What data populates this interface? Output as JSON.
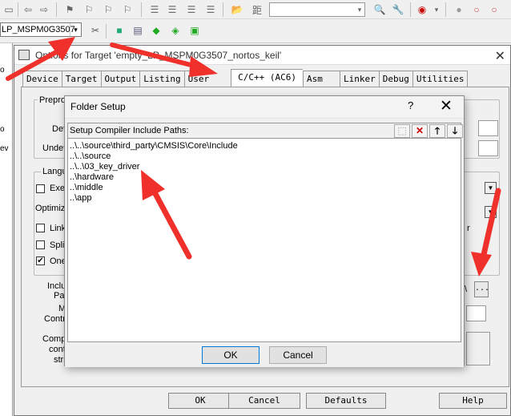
{
  "toolbar": {
    "target_select": "LP_MSPM0G3507",
    "target_select_dropdown": "▾"
  },
  "left_panel": {
    "partial_texts": [
      "o",
      "o",
      "ev"
    ]
  },
  "options_window": {
    "title": "Options for Target 'empty_LP_MSPM0G3507_nortos_keil'",
    "close_label": "✕",
    "tabs": [
      "Device",
      "Target",
      "Output",
      "Listing",
      "User",
      "C/C++ (AC6)",
      "Asm",
      "Linker",
      "Debug",
      "Utilities"
    ],
    "active_tab": "C/C++ (AC6)",
    "partial_labels": {
      "preprocessor": "Prepro",
      "define": "Defi",
      "undefine": "Undef",
      "language": "Langu",
      "execute_only": "Exe",
      "optimization": "Optimiz",
      "link_time": "Link",
      "split": "Split",
      "one_elf": "One",
      "include_paths_1": "Inclu",
      "include_paths_2": "Pat",
      "misc_1": "M",
      "misc_2": "Contr",
      "compiler_1": "Comp",
      "compiler_2": "cont",
      "compiler_3": "stri",
      "right_fragment": "r",
      "include_field_fragment": "\\",
      "browse_button": "..."
    },
    "buttons": {
      "ok": "OK",
      "cancel": "Cancel",
      "defaults": "Defaults",
      "help": "Help"
    }
  },
  "folder_setup": {
    "title": "Folder Setup",
    "help_label": "?",
    "close_label": "✕",
    "header_label": "Setup Compiler Include Paths:",
    "paths": [
      "..\\..\\source\\third_party\\CMSIS\\Core\\Include",
      "..\\..\\source",
      "..\\..\\03_key_driver",
      "..\\hardware",
      "..\\middle",
      "..\\app"
    ],
    "ok_label": "OK",
    "cancel_label": "Cancel"
  },
  "colors": {
    "annotation_arrow": "#f0302a",
    "dialog_default_border": "#0078d7",
    "delete_icon": "#cc0000"
  },
  "icons": [
    "new-folder-icon",
    "delete-icon",
    "move-up-icon",
    "move-down-icon"
  ]
}
